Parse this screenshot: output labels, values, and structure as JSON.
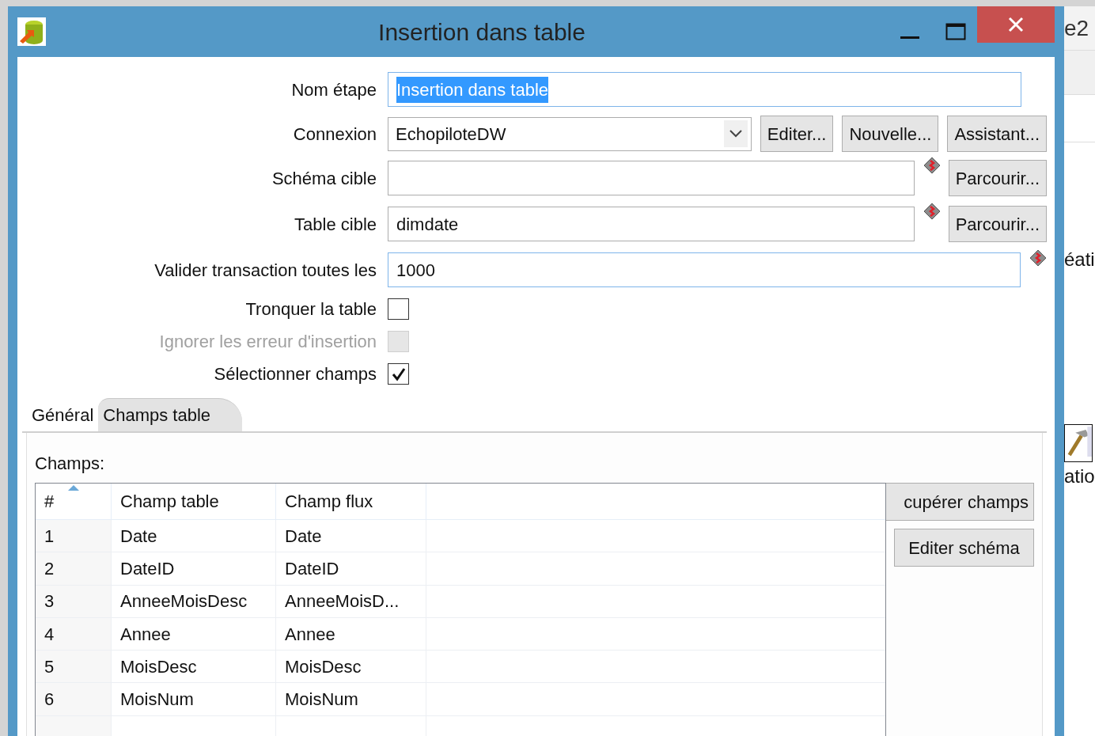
{
  "window": {
    "title": "Insertion dans table"
  },
  "fields": [
    {
      "kind": "text",
      "label": "Nom étape",
      "value": "Insertion dans table",
      "highlighted": true,
      "text_selected": true
    },
    {
      "kind": "select",
      "label": "Connexion",
      "value": "EchopiloteDW",
      "buttons": [
        "Editer...",
        "Nouvelle...",
        "Assistant..."
      ]
    },
    {
      "kind": "text",
      "label": "Schéma cible",
      "highlighted": false,
      "required": true,
      "buttons": [
        "Parcourir..."
      ]
    },
    {
      "kind": "text",
      "label": "Table cible",
      "value": "dimdate",
      "highlighted": false,
      "required": true,
      "buttons": [
        "Parcourir..."
      ]
    },
    {
      "kind": "text",
      "label": "Valider transaction toutes les",
      "value": "1000",
      "highlighted": true,
      "required": true
    },
    {
      "kind": "checkbox",
      "label": "Tronquer la table",
      "checked": false,
      "disabled": false
    },
    {
      "kind": "checkbox",
      "label": "Ignorer les erreur d'insertion",
      "checked": false,
      "disabled": true
    },
    {
      "kind": "checkbox",
      "label": "Sélectionner champs",
      "checked": true,
      "disabled": false
    }
  ],
  "tabs": [
    {
      "label": "Général",
      "selected": false
    },
    {
      "label": "Champs table",
      "selected": true
    }
  ],
  "panel": {
    "label": "Champs:",
    "table": {
      "columns": [
        {
          "label": "#",
          "sorted": true,
          "ascending": true
        },
        {
          "label": "Champ table",
          "sorted": false
        },
        {
          "label": "Champ flux",
          "sorted": false
        }
      ],
      "rows": [
        [
          "1",
          "Date",
          "Date"
        ],
        [
          "2",
          "DateID",
          "DateID"
        ],
        [
          "3",
          "AnneeMoisDesc",
          "AnneeMoisD..."
        ],
        [
          "4",
          "Annee",
          "Annee"
        ],
        [
          "5",
          "MoisDesc",
          "MoisDesc"
        ],
        [
          "6",
          "MoisNum",
          "MoisNum"
        ]
      ]
    },
    "buttons": [
      "cupérer champs",
      "Editer schéma"
    ]
  },
  "background": {
    "texts": [
      "e2",
      "éati",
      "atio"
    ]
  }
}
